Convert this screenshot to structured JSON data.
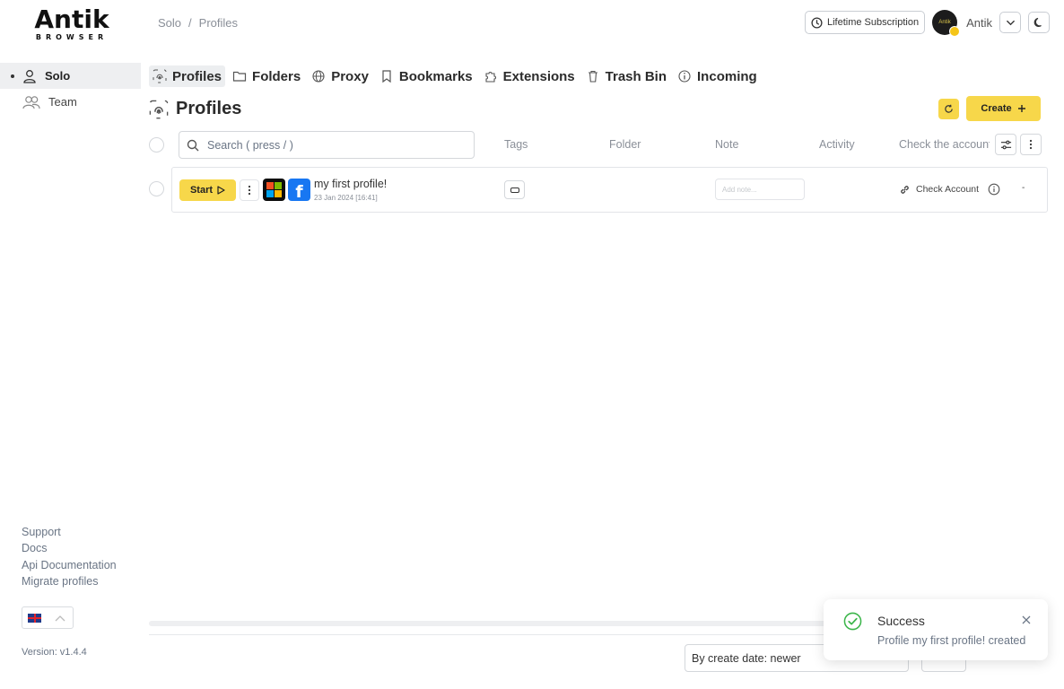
{
  "logo": {
    "main": "Antik",
    "sub": "BROWSER"
  },
  "breadcrumb": {
    "first": "Solo",
    "separator": "/",
    "second": "Profiles"
  },
  "header": {
    "subscription_label": "Lifetime Subscription",
    "user_name": "Antik",
    "avatar_text": "Antik"
  },
  "sidebar": {
    "items": [
      {
        "label": "Solo",
        "icon": "user-icon",
        "active": true
      },
      {
        "label": "Team",
        "icon": "users-icon",
        "active": false
      }
    ],
    "links": [
      "Support",
      "Docs",
      "Api Documentation",
      "Migrate profiles"
    ],
    "version": "Version: v1.4.4"
  },
  "tabs": [
    {
      "label": "Profiles",
      "icon": "fingerprint-icon",
      "active": true
    },
    {
      "label": "Folders",
      "icon": "folder-icon"
    },
    {
      "label": "Proxy",
      "icon": "globe-icon"
    },
    {
      "label": "Bookmarks",
      "icon": "bookmark-icon"
    },
    {
      "label": "Extensions",
      "icon": "puzzle-icon"
    },
    {
      "label": "Trash Bin",
      "icon": "trash-icon"
    },
    {
      "label": "Incoming",
      "icon": "info-icon"
    }
  ],
  "page": {
    "title": "Profiles",
    "create_label": "Create",
    "search_placeholder": "Search ( press / )"
  },
  "columns": {
    "tags": "Tags",
    "folder": "Folder",
    "note": "Note",
    "activity": "Activity",
    "check": "Check the account"
  },
  "profiles": [
    {
      "start_label": "Start",
      "name": "my first profile!",
      "date": "23 Jan 2024 [16:41]",
      "note_placeholder": "Add note...",
      "check_label": "Check Account",
      "activity": "-",
      "os": "windows",
      "platform": "facebook"
    }
  ],
  "footer": {
    "sort_value": "By create date: newer"
  },
  "toast": {
    "title": "Success",
    "message": "Profile my first profile! created"
  },
  "colors": {
    "accent": "#f7d74a",
    "success": "#3bb54a",
    "facebook": "#1877f2"
  }
}
